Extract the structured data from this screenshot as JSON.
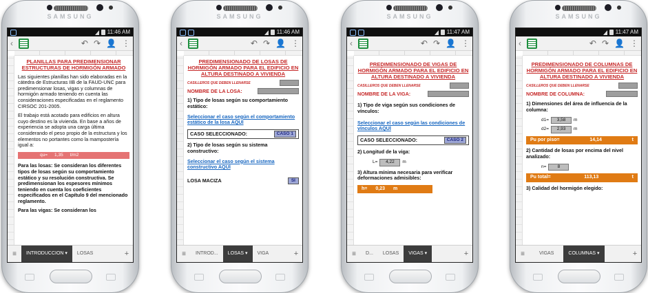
{
  "phones": {
    "p1": {
      "brand": "SAMSUNG",
      "time": "11:46 AM",
      "title": "PLANILLAS PARA PREDIMENSIONAR ESTRUCTURAS DE HORMIGÓN ARMADO",
      "para1": "Las siguientes planillas han sido elaboradas en la cátedra de Estructuras IIB de la FAUD-UNC para predimensionar losas, vigas y columnas de hormigón armado teniendo en cuenta las consideraciones especificadas en el reglamento CIRSOC 201-2005.",
      "para2": "El trabajo está acotado para edificios en altura cuyo destino es la vivienda. En base a años de experiencia se adopta una carga última considerando el peso propio de la estructura y los elementos no portantes como la mampostería igual a:",
      "qu_label": "qu=",
      "qu_value": "1,35",
      "qu_unit": "t/m2",
      "para3": "Para las losas: Se consideran los diferentes tipos de losas según su comportamiento estático y su resolución constructiva. Se predimensionan los espesores mínimos teniendo en cuenta los coeficientes especificados en el Capítulo 9 del mencionado reglamento.",
      "para4": "Para las vigas: Se consideran los",
      "tabs": [
        "INTRODUCCION",
        "LOSAS"
      ]
    },
    "p2": {
      "brand": "SAMSUNG",
      "time": "11:46 AM",
      "title": "PREDIMENSIONADO DE LOSAS DE HORMIGÓN ARMADO PARA EL EDIFICIO EN ALTURA DESTINADO A VIVIENDA",
      "fill_note": "CASILLEROS QUE DEBEN LLENARSE",
      "name_label": "NOMBRE DE LA LOSA:",
      "q1": "1) Tipo de losas según su comportamiento estático:",
      "link1": "Seleccionar el caso según el comportamiento estático de la losa  AQUÍ",
      "case_label": "CASO SELECCIONADO:",
      "case_value": "CASO 1",
      "q2": "2) Tipo de losas según su sistema constructivo:",
      "link2": "Seleccionar el caso según el sistema constructivo AQUÍ",
      "maciza_label": "LOSA MACIZA",
      "maciza_value": "SI",
      "tabs": [
        "INTROD...",
        "LOSAS",
        "VIGA"
      ]
    },
    "p3": {
      "brand": "SAMSUNG",
      "time": "11:47 AM",
      "title": "PREDIMENSIONADO DE VIGAS DE HORMIGÓN ARMADO PARA EL EDIFICIO EN ALTURA DESTINADO A VIVIENDA",
      "fill_note": "CASILLEROS QUE DEBEN LLENARSE",
      "name_label": "NOMBRE DE LA VIGA:",
      "q1": "1) Tipo de viga según sus condiciones de vínculos:",
      "link1": "Seleccionar el caso según las condiciones de vínculos  AQUÍ",
      "case_label": "CASO SELECCIONADO:",
      "case_value": "CASO 2",
      "q2": "2) Longitud de la viga:",
      "l_label": "L=",
      "l_value": "4,22",
      "l_unit": "m",
      "q3": "3) Altura mínima necesaria para verificar deformaciones admisibles:",
      "h_label": "h=",
      "h_value": "0,23",
      "h_unit": "m",
      "tabs": [
        "D...",
        "LOSAS",
        "VIGAS"
      ]
    },
    "p4": {
      "brand": "SAMSUNG",
      "time": "11:47 AM",
      "title": "PREDIMENSIONADO DE COLUMNAS DE HORMIGÓN ARMADO PARA EL EDIFICIO EN ALTURA DESTINADO A VIVIENDA",
      "fill_note": "CASILLEROS QUE DEBEN LLENARSE",
      "name_label": "NOMBRE DE COLUMNA:",
      "q1": "1) Dimensiones del área de influencia de la columna:",
      "d1_label": "d1=",
      "d1_value": "3,58",
      "d1_unit": "m",
      "d2_label": "d2=",
      "d2_value": "2,93",
      "d2_unit": "m",
      "pu_piso_label": "Pu por piso=",
      "pu_piso_value": "14,14",
      "pu_piso_unit": "t",
      "q2": "2) Cantidad de losas por encima del nivel analizado:",
      "n_label": "n=",
      "n_value": "8",
      "pu_total_label": "Pu total=",
      "pu_total_value": "113,13",
      "pu_total_unit": "t",
      "q3": "3) Calidad del hormigón elegido:",
      "tabs": [
        "VIGAS",
        "COLUMNAS"
      ]
    }
  }
}
